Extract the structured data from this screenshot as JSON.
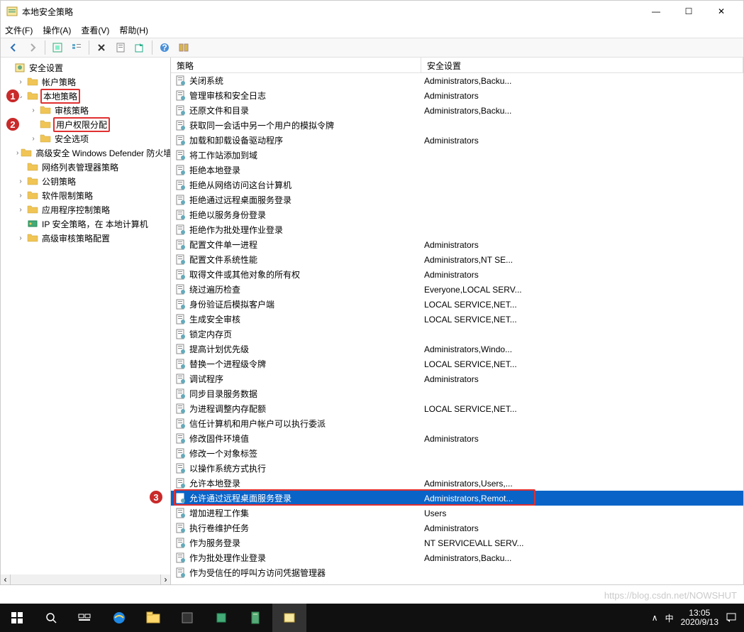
{
  "window": {
    "title": "本地安全策略"
  },
  "winbtns": {
    "min": "—",
    "max": "☐",
    "close": "✕"
  },
  "menu": {
    "file": "文件(F)",
    "action": "操作(A)",
    "view": "查看(V)",
    "help": "帮助(H)"
  },
  "tree": {
    "root": "安全设置",
    "items": [
      {
        "label": "帐户策略",
        "indent": 1,
        "exp": "›"
      },
      {
        "label": "本地策略",
        "indent": 1,
        "exp": "⌄",
        "hl": true,
        "badge": "1"
      },
      {
        "label": "审核策略",
        "indent": 2,
        "exp": "›"
      },
      {
        "label": "用户权限分配",
        "indent": 2,
        "exp": "",
        "hl": true,
        "badge": "2"
      },
      {
        "label": "安全选项",
        "indent": 2,
        "exp": "›"
      },
      {
        "label": "高级安全 Windows Defender 防火墙",
        "indent": 1,
        "exp": "›"
      },
      {
        "label": "网络列表管理器策略",
        "indent": 1,
        "exp": ""
      },
      {
        "label": "公钥策略",
        "indent": 1,
        "exp": "›"
      },
      {
        "label": "软件限制策略",
        "indent": 1,
        "exp": "›"
      },
      {
        "label": "应用程序控制策略",
        "indent": 1,
        "exp": "›"
      },
      {
        "label": "IP 安全策略，在 本地计算机",
        "indent": 1,
        "exp": "",
        "special": "ip"
      },
      {
        "label": "高级审核策略配置",
        "indent": 1,
        "exp": "›"
      }
    ]
  },
  "columns": {
    "policy": "策略",
    "setting": "安全设置"
  },
  "policies": [
    {
      "n": "关闭系统",
      "s": "Administrators,Backu..."
    },
    {
      "n": "管理审核和安全日志",
      "s": "Administrators"
    },
    {
      "n": "还原文件和目录",
      "s": "Administrators,Backu..."
    },
    {
      "n": "获取同一会话中另一个用户的模拟令牌",
      "s": ""
    },
    {
      "n": "加载和卸载设备驱动程序",
      "s": "Administrators"
    },
    {
      "n": "将工作站添加到域",
      "s": ""
    },
    {
      "n": "拒绝本地登录",
      "s": ""
    },
    {
      "n": "拒绝从网络访问这台计算机",
      "s": ""
    },
    {
      "n": "拒绝通过远程桌面服务登录",
      "s": ""
    },
    {
      "n": "拒绝以服务身份登录",
      "s": ""
    },
    {
      "n": "拒绝作为批处理作业登录",
      "s": ""
    },
    {
      "n": "配置文件单一进程",
      "s": "Administrators"
    },
    {
      "n": "配置文件系统性能",
      "s": "Administrators,NT SE..."
    },
    {
      "n": "取得文件或其他对象的所有权",
      "s": "Administrators"
    },
    {
      "n": "绕过遍历检查",
      "s": "Everyone,LOCAL SERV..."
    },
    {
      "n": "身份验证后模拟客户端",
      "s": "LOCAL SERVICE,NET..."
    },
    {
      "n": "生成安全审核",
      "s": "LOCAL SERVICE,NET..."
    },
    {
      "n": "锁定内存页",
      "s": ""
    },
    {
      "n": "提高计划优先级",
      "s": "Administrators,Windo..."
    },
    {
      "n": "替换一个进程级令牌",
      "s": "LOCAL SERVICE,NET..."
    },
    {
      "n": "调试程序",
      "s": "Administrators"
    },
    {
      "n": "同步目录服务数据",
      "s": ""
    },
    {
      "n": "为进程调整内存配额",
      "s": "LOCAL SERVICE,NET..."
    },
    {
      "n": "信任计算机和用户帐户可以执行委派",
      "s": ""
    },
    {
      "n": "修改固件环境值",
      "s": "Administrators"
    },
    {
      "n": "修改一个对象标签",
      "s": ""
    },
    {
      "n": "以操作系统方式执行",
      "s": ""
    },
    {
      "n": "允许本地登录",
      "s": "Administrators,Users,..."
    },
    {
      "n": "允许通过远程桌面服务登录",
      "s": "Administrators,Remot...",
      "sel": true,
      "badge": "3"
    },
    {
      "n": "增加进程工作集",
      "s": "Users"
    },
    {
      "n": "执行卷维护任务",
      "s": "Administrators"
    },
    {
      "n": "作为服务登录",
      "s": "NT SERVICE\\ALL SERV..."
    },
    {
      "n": "作为批处理作业登录",
      "s": "Administrators,Backu..."
    },
    {
      "n": "作为受信任的呼叫方访问凭据管理器",
      "s": ""
    }
  ],
  "badge3": "3",
  "taskbar": {
    "time": "13:05",
    "date": "2020/9/13",
    "ime": "中"
  },
  "watermark": "https://blog.csdn.net/NOWSHUT"
}
